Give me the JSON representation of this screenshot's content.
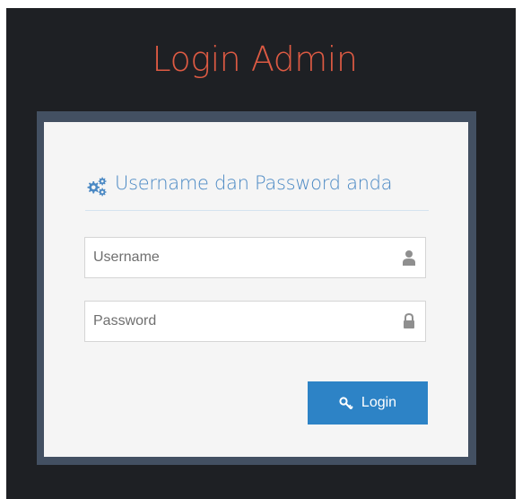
{
  "page": {
    "title": "Login Admin"
  },
  "form": {
    "header_icon": "cogs-icon",
    "header_text": "Username dan Password anda",
    "username": {
      "placeholder": "Username",
      "value": "",
      "icon": "user-icon"
    },
    "password": {
      "placeholder": "Password",
      "value": "",
      "icon": "lock-icon"
    },
    "login_button": {
      "label": "Login",
      "icon": "key-icon"
    }
  },
  "colors": {
    "background": "#1e2024",
    "title": "#dd5a43",
    "card_border": "#435062",
    "card_bg": "#f5f5f5",
    "header_text": "#4b89c4",
    "button_bg": "#2d83c6"
  }
}
